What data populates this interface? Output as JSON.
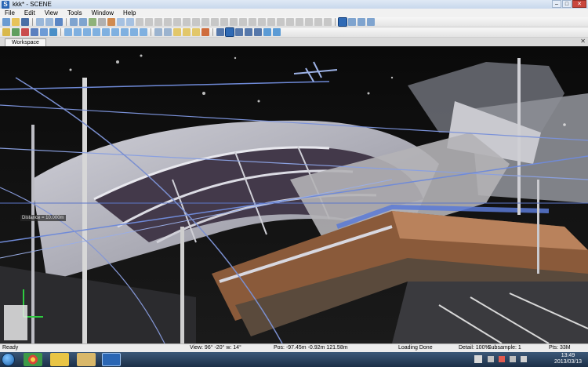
{
  "window": {
    "title": "kkk* - SCENE",
    "app_icon_letter": "S"
  },
  "menu": [
    "File",
    "Edit",
    "View",
    "Tools",
    "Window",
    "Help"
  ],
  "tabs": [
    {
      "label": "Workspace"
    }
  ],
  "viewport": {
    "distance_label": "Distance = 10.000m"
  },
  "status": {
    "ready": "Ready",
    "view": "View: 96° -20° w: 14°",
    "pos": "Pos: -97.45m -0.92m 121.58m",
    "loading": "Loading Done",
    "detail": "Detail: 100%",
    "subsample": "Subsample: 1",
    "pts": "Pts: 33M"
  },
  "taskbar": {
    "time": "13:49",
    "date": "2013/03/13"
  },
  "colors": {
    "titlebar": "#c8d8ec",
    "close": "#c9463d",
    "taskbar": "#1c2f47"
  }
}
